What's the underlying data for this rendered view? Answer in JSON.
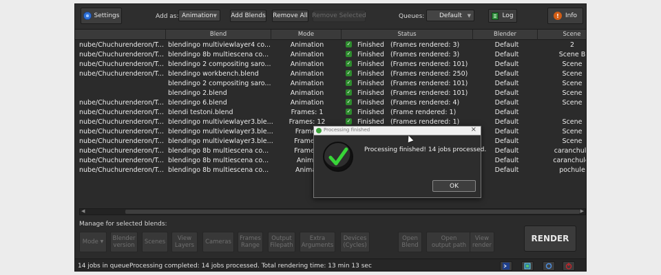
{
  "toolbar": {
    "settings_label": "Settings",
    "add_as_label": "Add as:",
    "add_as_value": "Animation",
    "add_blends_label": "Add Blends",
    "remove_all_label": "Remove All",
    "remove_selected_label": "Remove Selected",
    "queues_label": "Queues:",
    "queues_value": "Default",
    "log_label": "Log",
    "info_label": "Info"
  },
  "table": {
    "columns": [
      "Blend",
      "Mode",
      "Status",
      "Blender",
      "Scene"
    ],
    "rows": [
      {
        "path": "nube/Chuchurenderon/T...",
        "blend": "blendingo multiviewlayer4 co...",
        "mode": "Animation",
        "status": "Finished   (Frames rendered: 3)",
        "blender": "Default",
        "scene": "2"
      },
      {
        "path": "nube/Chuchurenderon/T...",
        "blend": "blendingo 8b multiescena co...",
        "mode": "Animation",
        "status": "Finished   (Frames rendered: 3)",
        "blender": "Default",
        "scene": "Scene B"
      },
      {
        "path": "nube/Chuchurenderon/T...",
        "blend": "blendingo 2 compositing saro...",
        "mode": "Animation",
        "status": "Finished   (Frames rendered: 101)",
        "blender": "Default",
        "scene": "Scene"
      },
      {
        "path": "nube/Chuchurenderon/T...",
        "blend": "blendingo workbench.blend",
        "mode": "Animation",
        "status": "Finished   (Frames rendered: 250)",
        "blender": "Default",
        "scene": "Scene"
      },
      {
        "path": "",
        "blend": "blendingo 2 compositing saro...",
        "mode": "Animation",
        "status": "Finished   (Frames rendered: 101)",
        "blender": "Default",
        "scene": "Scene"
      },
      {
        "path": "",
        "blend": "blendingo 2.blend",
        "mode": "Animation",
        "status": "Finished   (Frames rendered: 101)",
        "blender": "Default",
        "scene": "Scene"
      },
      {
        "path": "nube/Chuchurenderon/T...",
        "blend": "blendingo 6.blend",
        "mode": "Animation",
        "status": "Finished   (Frames rendered: 4)",
        "blender": "Default",
        "scene": "Scene"
      },
      {
        "path": "nube/Chuchurenderon/T...",
        "blend": "blendi testoni.blend",
        "mode": "Frames: 1",
        "status": "Finished   (Frame rendered: 1)",
        "blender": "Default",
        "scene": ""
      },
      {
        "path": "nube/Chuchurenderon/T...",
        "blend": "blendingo multiviewlayer3.ble...",
        "mode": "Frames: 12",
        "status": "Finished   (Frames rendered: 1)",
        "blender": "Default",
        "scene": "Scene"
      },
      {
        "path": "nube/Chuchurenderon/T...",
        "blend": "blendingo multiviewlayer3.ble...",
        "mode": "Frames",
        "status": "",
        "blender": "Default",
        "scene": "Scene"
      },
      {
        "path": "nube/Chuchurenderon/T...",
        "blend": "blendingo multiviewlayer3.ble...",
        "mode": "Frames:",
        "status": "",
        "blender": "Default",
        "scene": "Scene"
      },
      {
        "path": "nube/Chuchurenderon/T...",
        "blend": "blendingo 8b multiescena co...",
        "mode": "Frames:",
        "status": "",
        "blender": "Default",
        "scene": "caranchule"
      },
      {
        "path": "nube/Chuchurenderon/T...",
        "blend": "blendingo 8b multiescena co...",
        "mode": "Anima",
        "status": "",
        "blender": "Default",
        "scene": "caranchule."
      },
      {
        "path": "nube/Chuchurenderon/T...",
        "blend": "blendingo 8b multiescena co...",
        "mode": "Animat",
        "status": "",
        "blender": "Default",
        "scene": "pochule"
      }
    ]
  },
  "manage": {
    "label": "Manage for selected blends:",
    "buttons": {
      "mode": "Mode",
      "blender_version_1": "Blender",
      "blender_version_2": "version",
      "scenes": "Scenes",
      "view_layers_1": "View",
      "view_layers_2": "Layers",
      "cameras": "Cameras",
      "frames_range_1": "Frames",
      "frames_range_2": "Range",
      "output_filepath_1": "Output",
      "output_filepath_2": "Filepath",
      "extra_arguments_1": "Extra",
      "extra_arguments_2": "Arguments",
      "devices_1": "Devices",
      "devices_2": "(Cycles)",
      "open_blend_1": "Open",
      "open_blend_2": "Blend",
      "open_output_path_1": "Open",
      "open_output_path_2": "output path",
      "view_render_1": "View",
      "view_render_2": "render"
    },
    "render_label": "RENDER"
  },
  "statusbar": {
    "jobs_in_queue": "14 jobs in queue",
    "message": "Processing completed: 14 jobs processed. Total rendering time: 13 min 13 sec"
  },
  "dialog": {
    "title": "Processing finished",
    "message": "Processing finished! 14 jobs processed.",
    "ok_label": "OK"
  },
  "colors": {
    "app_bg": "#2b2b2b",
    "success_green": "#3ca23c",
    "info_orange": "#d35d14",
    "power_red": "#c0262c"
  }
}
